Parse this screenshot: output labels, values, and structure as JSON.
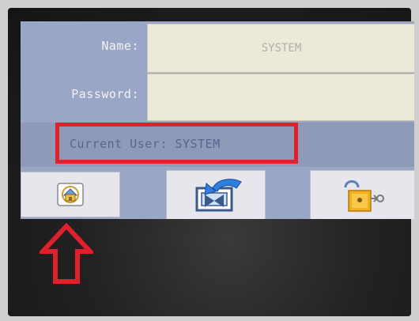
{
  "login": {
    "name_label": "Name:",
    "password_label": "Password:",
    "name_value": "SYSTEM",
    "password_value": "",
    "current_user_text": "Current User: SYSTEM"
  },
  "buttons": {
    "home_icon": "home-icon",
    "transfer_icon": "transfer-icon",
    "logout_icon": "logout-icon"
  },
  "colors": {
    "highlight": "#e0202a",
    "screen_bg": "#9aa6c6",
    "field_bg": "#ece9da"
  }
}
